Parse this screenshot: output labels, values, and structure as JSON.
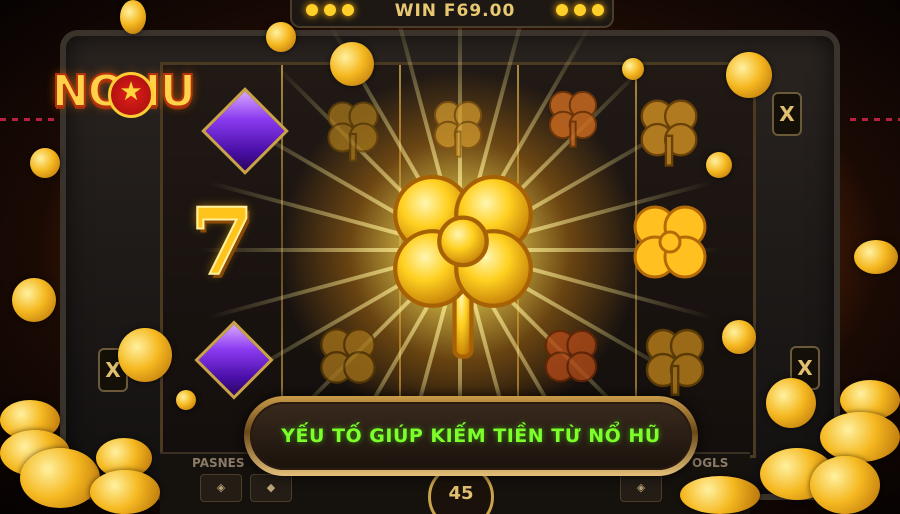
{
  "header": {
    "win_display": "WIN F69.00"
  },
  "logo": {
    "text": "NOHU"
  },
  "reel_symbols": {
    "seven": "7"
  },
  "side_markers": {
    "left": "X",
    "right": "X"
  },
  "banner": {
    "title": "YẾU TỐ GIÚP KIẾM TIỀN TỪ NỔ HŨ"
  },
  "bottom_panel": {
    "left_label": "PASNES",
    "right_label": "OGLS",
    "bet_display": "45"
  },
  "colors": {
    "banner_text": "#7dff2a",
    "gold": "#ffc41c",
    "gem": "#8a3bf0"
  }
}
